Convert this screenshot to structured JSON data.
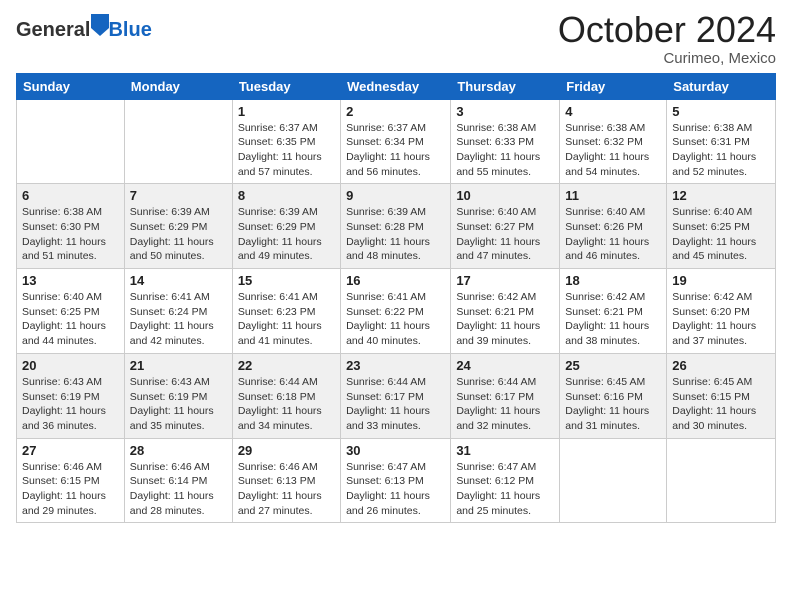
{
  "header": {
    "logo_general": "General",
    "logo_blue": "Blue",
    "month": "October 2024",
    "location": "Curimeo, Mexico"
  },
  "days_of_week": [
    "Sunday",
    "Monday",
    "Tuesday",
    "Wednesday",
    "Thursday",
    "Friday",
    "Saturday"
  ],
  "weeks": [
    [
      {
        "day": "",
        "detail": ""
      },
      {
        "day": "",
        "detail": ""
      },
      {
        "day": "1",
        "detail": "Sunrise: 6:37 AM\nSunset: 6:35 PM\nDaylight: 11 hours and 57 minutes."
      },
      {
        "day": "2",
        "detail": "Sunrise: 6:37 AM\nSunset: 6:34 PM\nDaylight: 11 hours and 56 minutes."
      },
      {
        "day": "3",
        "detail": "Sunrise: 6:38 AM\nSunset: 6:33 PM\nDaylight: 11 hours and 55 minutes."
      },
      {
        "day": "4",
        "detail": "Sunrise: 6:38 AM\nSunset: 6:32 PM\nDaylight: 11 hours and 54 minutes."
      },
      {
        "day": "5",
        "detail": "Sunrise: 6:38 AM\nSunset: 6:31 PM\nDaylight: 11 hours and 52 minutes."
      }
    ],
    [
      {
        "day": "6",
        "detail": "Sunrise: 6:38 AM\nSunset: 6:30 PM\nDaylight: 11 hours and 51 minutes."
      },
      {
        "day": "7",
        "detail": "Sunrise: 6:39 AM\nSunset: 6:29 PM\nDaylight: 11 hours and 50 minutes."
      },
      {
        "day": "8",
        "detail": "Sunrise: 6:39 AM\nSunset: 6:29 PM\nDaylight: 11 hours and 49 minutes."
      },
      {
        "day": "9",
        "detail": "Sunrise: 6:39 AM\nSunset: 6:28 PM\nDaylight: 11 hours and 48 minutes."
      },
      {
        "day": "10",
        "detail": "Sunrise: 6:40 AM\nSunset: 6:27 PM\nDaylight: 11 hours and 47 minutes."
      },
      {
        "day": "11",
        "detail": "Sunrise: 6:40 AM\nSunset: 6:26 PM\nDaylight: 11 hours and 46 minutes."
      },
      {
        "day": "12",
        "detail": "Sunrise: 6:40 AM\nSunset: 6:25 PM\nDaylight: 11 hours and 45 minutes."
      }
    ],
    [
      {
        "day": "13",
        "detail": "Sunrise: 6:40 AM\nSunset: 6:25 PM\nDaylight: 11 hours and 44 minutes."
      },
      {
        "day": "14",
        "detail": "Sunrise: 6:41 AM\nSunset: 6:24 PM\nDaylight: 11 hours and 42 minutes."
      },
      {
        "day": "15",
        "detail": "Sunrise: 6:41 AM\nSunset: 6:23 PM\nDaylight: 11 hours and 41 minutes."
      },
      {
        "day": "16",
        "detail": "Sunrise: 6:41 AM\nSunset: 6:22 PM\nDaylight: 11 hours and 40 minutes."
      },
      {
        "day": "17",
        "detail": "Sunrise: 6:42 AM\nSunset: 6:21 PM\nDaylight: 11 hours and 39 minutes."
      },
      {
        "day": "18",
        "detail": "Sunrise: 6:42 AM\nSunset: 6:21 PM\nDaylight: 11 hours and 38 minutes."
      },
      {
        "day": "19",
        "detail": "Sunrise: 6:42 AM\nSunset: 6:20 PM\nDaylight: 11 hours and 37 minutes."
      }
    ],
    [
      {
        "day": "20",
        "detail": "Sunrise: 6:43 AM\nSunset: 6:19 PM\nDaylight: 11 hours and 36 minutes."
      },
      {
        "day": "21",
        "detail": "Sunrise: 6:43 AM\nSunset: 6:19 PM\nDaylight: 11 hours and 35 minutes."
      },
      {
        "day": "22",
        "detail": "Sunrise: 6:44 AM\nSunset: 6:18 PM\nDaylight: 11 hours and 34 minutes."
      },
      {
        "day": "23",
        "detail": "Sunrise: 6:44 AM\nSunset: 6:17 PM\nDaylight: 11 hours and 33 minutes."
      },
      {
        "day": "24",
        "detail": "Sunrise: 6:44 AM\nSunset: 6:17 PM\nDaylight: 11 hours and 32 minutes."
      },
      {
        "day": "25",
        "detail": "Sunrise: 6:45 AM\nSunset: 6:16 PM\nDaylight: 11 hours and 31 minutes."
      },
      {
        "day": "26",
        "detail": "Sunrise: 6:45 AM\nSunset: 6:15 PM\nDaylight: 11 hours and 30 minutes."
      }
    ],
    [
      {
        "day": "27",
        "detail": "Sunrise: 6:46 AM\nSunset: 6:15 PM\nDaylight: 11 hours and 29 minutes."
      },
      {
        "day": "28",
        "detail": "Sunrise: 6:46 AM\nSunset: 6:14 PM\nDaylight: 11 hours and 28 minutes."
      },
      {
        "day": "29",
        "detail": "Sunrise: 6:46 AM\nSunset: 6:13 PM\nDaylight: 11 hours and 27 minutes."
      },
      {
        "day": "30",
        "detail": "Sunrise: 6:47 AM\nSunset: 6:13 PM\nDaylight: 11 hours and 26 minutes."
      },
      {
        "day": "31",
        "detail": "Sunrise: 6:47 AM\nSunset: 6:12 PM\nDaylight: 11 hours and 25 minutes."
      },
      {
        "day": "",
        "detail": ""
      },
      {
        "day": "",
        "detail": ""
      }
    ]
  ]
}
